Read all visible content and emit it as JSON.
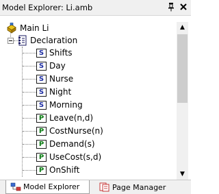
{
  "window": {
    "title": "Model Explorer: Li.amb",
    "pin_glyph": "ᵖ",
    "close_glyph": "×"
  },
  "tree": {
    "root": {
      "label": "Main Li",
      "icon": "model-icon"
    },
    "declaration": {
      "label": "Declaration",
      "icon": "declaration-icon"
    },
    "items": [
      {
        "badge": "S",
        "kind": "set",
        "label": "Shifts"
      },
      {
        "badge": "S",
        "kind": "set",
        "label": "Day"
      },
      {
        "badge": "S",
        "kind": "set",
        "label": "Nurse"
      },
      {
        "badge": "S",
        "kind": "set",
        "label": "Night"
      },
      {
        "badge": "S",
        "kind": "set",
        "label": "Morning"
      },
      {
        "badge": "P",
        "kind": "parameter",
        "label": "Leave(n,d)"
      },
      {
        "badge": "P",
        "kind": "parameter",
        "label": "CostNurse(n)"
      },
      {
        "badge": "P",
        "kind": "parameter",
        "label": "Demand(s)"
      },
      {
        "badge": "P",
        "kind": "parameter",
        "label": "UseCost(s,d)"
      },
      {
        "badge": "P",
        "kind": "parameter",
        "label": "OnShift"
      }
    ]
  },
  "scrollbar": {
    "up_glyph": "▲",
    "down_glyph": "▼"
  },
  "tabs": [
    {
      "label": "Model Explorer",
      "icon": "model-explorer-icon",
      "active": true
    },
    {
      "label": "Page Manager",
      "icon": "page-manager-icon",
      "active": false
    }
  ],
  "colors": {
    "set_badge": "#1a2aa0",
    "parameter_badge": "#0a7a12",
    "chrome": "#f0f0f0"
  }
}
